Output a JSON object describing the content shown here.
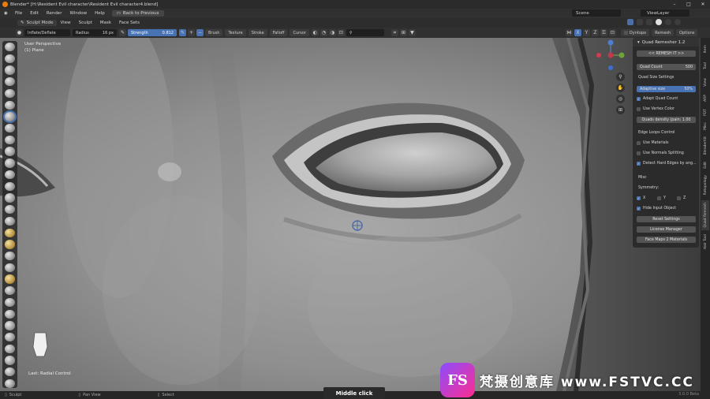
{
  "titlebar": {
    "title": "Blender* [H:\\Resident Evil character\\Resident Evil character4.blend]"
  },
  "menubar": {
    "items": [
      "File",
      "Edit",
      "Render",
      "Window",
      "Help"
    ],
    "back_label": "Back to Previous",
    "scene": "Scene",
    "view_layer": "ViewLayer"
  },
  "header2": {
    "mode": "Sculpt Mode",
    "items": [
      "View",
      "Sculpt",
      "Mask",
      "Face Sets"
    ]
  },
  "toolhdr": {
    "brush": "Inflate/Deflate",
    "radius_label": "Radius",
    "radius_value": "16 px",
    "strength_label": "Strength",
    "strength_value": "0.812",
    "brush_dd": "Brush",
    "texture_dd": "Texture",
    "stroke_dd": "Stroke",
    "falloff_dd": "Falloff",
    "cursor_dd": "Cursor",
    "axis_x": "X",
    "axis_y": "Y",
    "axis_z": "Z",
    "dyntopo_dd": "Dyntopo",
    "remesh_dd": "Remesh",
    "options_dd": "Options"
  },
  "viewport": {
    "perspective": "User Perspective",
    "object": "(1) Plane",
    "last_op": "Last: Radial Control"
  },
  "npanel": {
    "title": "Quad Remesher 1.2",
    "remesh_btn": "<< REMESH IT >>",
    "quad_count_label": "Quad Count",
    "quad_count_value": "500",
    "quad_size_settings": "Quad Size Settings",
    "adaptive_label": "Adaptive size",
    "adaptive_value": "50%",
    "adapt_quad_count": "Adapt Quad Count",
    "use_vertex_color": "Use Vertex Color",
    "quads_density": "Quads density (pain: 1.00",
    "edge_loops_control": "Edge Loops Control",
    "use_materials": "Use Materials",
    "use_normals_splitting": "Use Normals Splitting",
    "detect_hard_edges": "Detect Hard Edges by ang...",
    "misc": "Misc",
    "symmetry": "Symmetry:",
    "sym_x": "X",
    "sym_y": "Y",
    "sym_z": "Z",
    "hide_input": "Hide Input Object",
    "reset_settings": "Reset Settings",
    "license_manager": "License Manager",
    "face_maps": "Face Maps 2 Materials"
  },
  "side_tabs": [
    "Item",
    "Tool",
    "View",
    "ARP",
    "PDT",
    "Misc",
    "BlenderKit",
    "Edit",
    "Retopology",
    "Quad Remesh",
    "Hair Tool"
  ],
  "statusbar": {
    "left": "Sculpt",
    "pan": "Pan View",
    "select": "Select",
    "version": "3.0.0 Beta"
  },
  "overlay": {
    "middle_click": "Middle click"
  },
  "watermark": {
    "badge": "FS",
    "text": "梵摄创意库 www.FSTVC.CC"
  },
  "colors": {
    "accent": "#4772b3",
    "panel": "#2b2b2b",
    "header": "#303030"
  }
}
